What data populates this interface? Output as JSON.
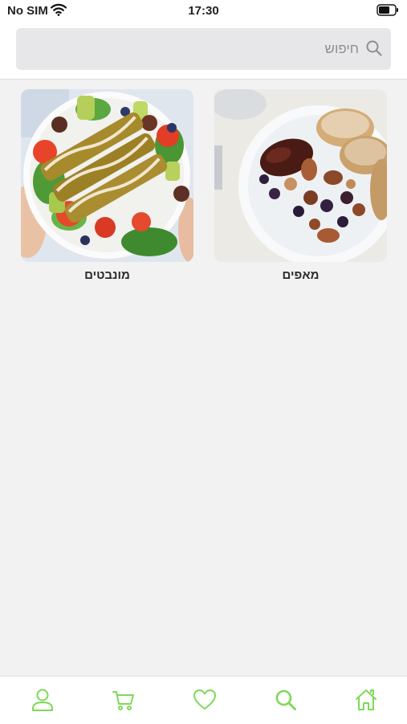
{
  "status_bar": {
    "carrier": "No SIM",
    "time": "17:30",
    "wifi_icon": "wifi-icon",
    "battery_icon": "battery-icon"
  },
  "search": {
    "placeholder": "חיפוש",
    "value": "",
    "icon": "search-icon"
  },
  "categories": [
    {
      "label": "מאפים",
      "image": "plate-of-dates-and-nuts-photo"
    },
    {
      "label": "מונבטים",
      "image": "green-salad-with-sprouted-patties-photo"
    }
  ],
  "tab_bar": {
    "accent_color": "#7ed957",
    "items": [
      {
        "icon": "home-icon"
      },
      {
        "icon": "search-icon"
      },
      {
        "icon": "heart-icon"
      },
      {
        "icon": "cart-icon"
      },
      {
        "icon": "profile-icon"
      }
    ]
  }
}
